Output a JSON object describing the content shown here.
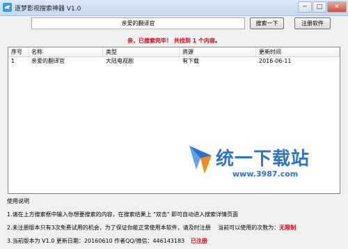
{
  "window": {
    "title": "逐梦影视搜索神器 V1.0",
    "minimize": "─",
    "maximize": "□",
    "close": "✕"
  },
  "search": {
    "value": "亲爱的翻译官",
    "button": "搜索一下",
    "register_button": "注册软件"
  },
  "status_text": "亲，已搜索完毕！ 共找到 1 个内容。",
  "table": {
    "headers": [
      "序号",
      "名称",
      "类型",
      "资源",
      "更新时间"
    ],
    "rows": [
      [
        "1",
        "亲爱的翻译官",
        "大陆电视剧",
        "有下载",
        "2016-06-11"
      ]
    ]
  },
  "watermark": {
    "text": "统一下载站",
    "url": "www.3987.com"
  },
  "help": {
    "title": "使用说明",
    "line1": "1.请在上方搜索框中输入你想要搜索的内容，在搜索结果上 \"双击\" 即可自动进入搜索详情页面",
    "line2_a": "2.未注册版本只有3次免费试用的机会，为了保证你能正常使用本软件，请及时注册",
    "line2_b": "当前可以使用的次数为：",
    "line2_c": "无限制",
    "line3_a": "3.当前版本为 V1.0 更新日期：20160610 作者QQ/微信：446143183",
    "line3_b": "已注册"
  }
}
